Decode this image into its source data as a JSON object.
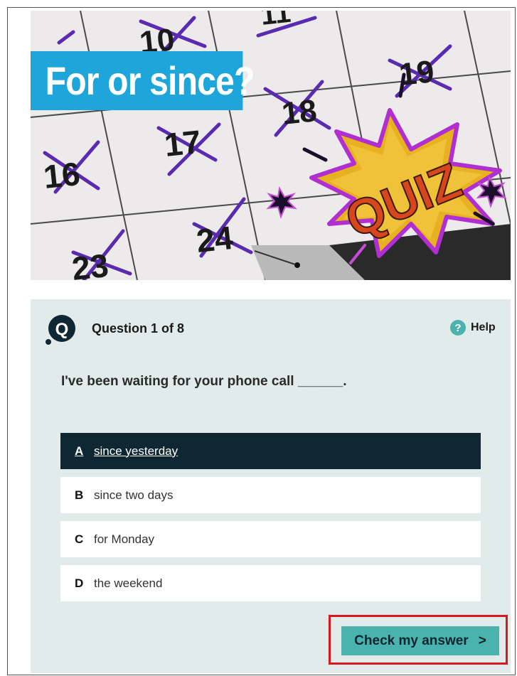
{
  "hero": {
    "title": "For or since?",
    "calendar_numbers": [
      "10",
      "11",
      "19",
      "18",
      "17",
      "16",
      "24",
      "23"
    ],
    "quiz_badge": "QUIZ"
  },
  "quiz": {
    "progress": "Question 1 of 8",
    "help_label": "Help",
    "help_icon_glyph": "?",
    "question_text": "I've been waiting for your phone call ______.",
    "options": [
      {
        "letter": "A",
        "text": "since yesterday",
        "selected": true
      },
      {
        "letter": "B",
        "text": "since two days",
        "selected": false
      },
      {
        "letter": "C",
        "text": "for Monday",
        "selected": false
      },
      {
        "letter": "D",
        "text": "the weekend",
        "selected": false
      }
    ],
    "check_label": "Check my answer",
    "check_arrow": ">"
  },
  "colors": {
    "banner": "#1ea6da",
    "panel": "#e0ebea",
    "accent": "#4ab3ad",
    "selected": "#0e2733",
    "highlight": "#d5191f"
  },
  "icons": {
    "question": "q-logo-icon",
    "help": "help-icon",
    "chevron": "chevron-right-icon"
  }
}
